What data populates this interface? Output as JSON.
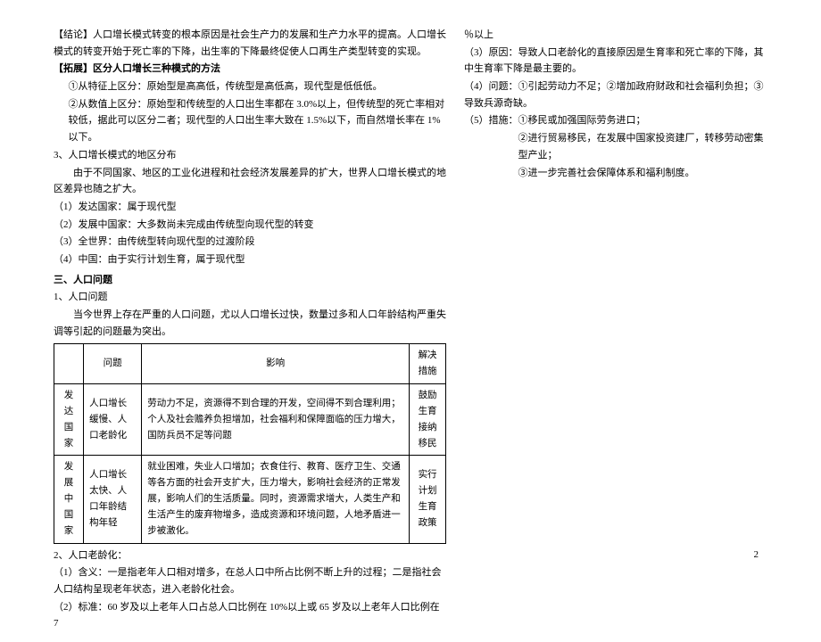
{
  "left": {
    "conclusion": "【结论】人口增长模式转变的根本原因是社会生产力的发展和生产力水平的提高。人口增长模式的转变开始于死亡率的下降，出生率的下降最终促使人口再生产类型转变的实现。",
    "expand_title": "【拓展】区分人口增长三种模式的方法",
    "expand1": "①从特征上区分：原始型是高高低，传统型是高低高，现代型是低低低。",
    "expand2": "②从数值上区分：原始型和传统型的人口出生率都在 3.0%以上，但传统型的死亡率相对较低，据此可以区分二者；现代型的人口出生率大致在 1.5%以下，而自然增长率在 1%以下。",
    "s3_title": "3、人口增长模式的地区分布",
    "s3_intro": "由于不同国家、地区的工业化进程和社会经济发展差异的扩大，世界人口增长模式的地区差异也随之扩大。",
    "s3_1": "（1）发达国家：属于现代型",
    "s3_2": "（2）发展中国家：大多数尚未完成由传统型向现代型的转变",
    "s3_3": "（3）全世界：由传统型转向现代型的过渡阶段",
    "s3_4": "（4）中国：由于实行计划生育，属于现代型",
    "sec3_title": "三、人口问题",
    "p1_title": "1、人口问题",
    "p1_body": "当今世界上存在严重的人口问题，尤以人口增长过快，数量过多和人口年龄结构严重失调等引起的问题最为突出。",
    "table": {
      "headers": [
        "",
        "问题",
        "影响",
        "解决措施"
      ],
      "rows": [
        {
          "region": "发达国家",
          "problem": "人口增长缓慢、人口老龄化",
          "impact": "劳动力不足，资源得不到合理的开发，空间得不到合理利用；个人及社会赡养负担增加，社会福利和保障面临的压力增大，国防兵员不足等问题",
          "solution": "鼓励生育 接纳移民"
        },
        {
          "region": "发展中国家",
          "problem": "人口增长太快、人口年龄结构年轻",
          "impact": "就业困难，失业人口增加；衣食住行、教育、医疗卫生、交通等各方面的社会开支扩大，压力增大，影响社会经济的正常发展，影响人们的生活质量。同时，资源需求增大，人类生产和生活产生的废弃物增多，造成资源和环境问题，人地矛盾进一步被激化。",
          "solution": "实行计划生育政策"
        }
      ]
    },
    "p2_title": "2、人口老龄化：",
    "p2_1": "（1）含义：一是指老年人口相对增多，在总人口中所占比例不断上升的过程；二是指社会人口结构呈现老年状态，进入老龄化社会。",
    "p2_2": "（2）标准：60 岁及以上老年人口占总人口比例在 10%以上或 65 岁及以上老年人口比例在 7"
  },
  "right": {
    "cont": "％以上",
    "p3": "（3）原因：导致人口老龄化的直接原因是生育率和死亡率的下降，其中生育率下降是最主要的。",
    "p4": "（4）问题：①引起劳动力不足；②增加政府财政和社会福利负担；③导致兵源奇缺。",
    "p5": "（5）措施：①移民或加强国际劳务进口；",
    "p5_2": "②进行贸易移民，在发展中国家投资建厂，转移劳动密集型产业；",
    "p5_3": "③进一步完善社会保障体系和福利制度。"
  },
  "page_number": "2"
}
